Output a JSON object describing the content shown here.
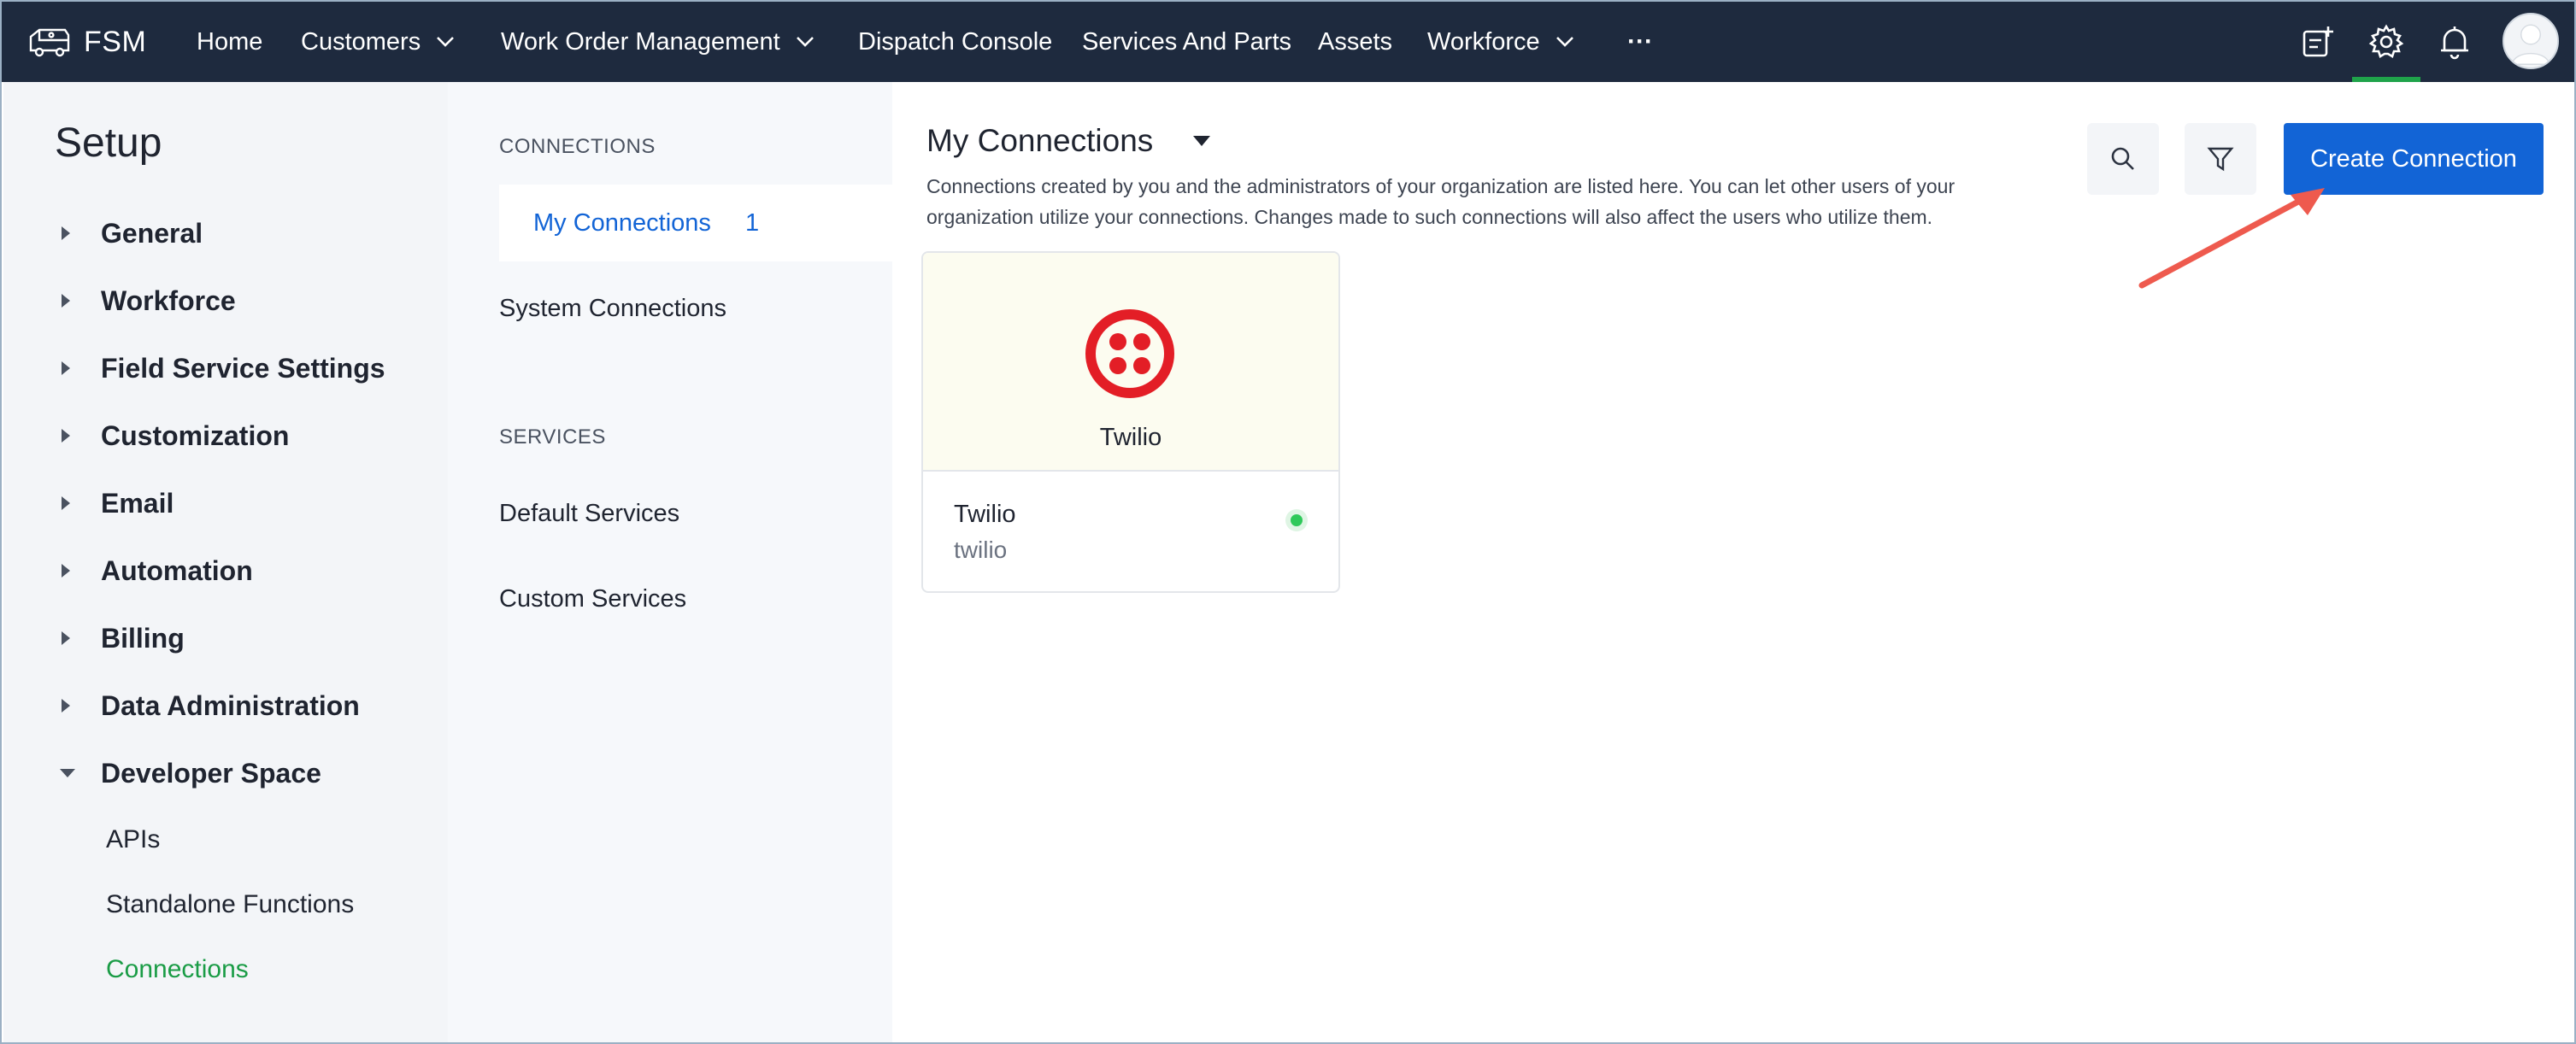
{
  "topnav": {
    "brand": "FSM",
    "items": [
      {
        "label": "Home",
        "has_dropdown": false
      },
      {
        "label": "Customers",
        "has_dropdown": true
      },
      {
        "label": "Work Order Management",
        "has_dropdown": true
      },
      {
        "label": "Dispatch Console",
        "has_dropdown": false
      },
      {
        "label": "Services And Parts",
        "has_dropdown": false
      },
      {
        "label": "Assets",
        "has_dropdown": false
      },
      {
        "label": "Workforce",
        "has_dropdown": true
      }
    ],
    "more": "···",
    "right_icons": [
      "add-note-icon",
      "gear-icon",
      "bell-icon",
      "avatar"
    ],
    "active_icon": "gear-icon",
    "colors": {
      "bar": "#1e2a3e",
      "active_indicator": "#1fa34a"
    }
  },
  "setup": {
    "title": "Setup",
    "items": [
      {
        "label": "General",
        "expanded": false
      },
      {
        "label": "Workforce",
        "expanded": false
      },
      {
        "label": "Field Service Settings",
        "expanded": false
      },
      {
        "label": "Customization",
        "expanded": false
      },
      {
        "label": "Email",
        "expanded": false
      },
      {
        "label": "Automation",
        "expanded": false
      },
      {
        "label": "Billing",
        "expanded": false
      },
      {
        "label": "Data Administration",
        "expanded": false
      },
      {
        "label": "Developer Space",
        "expanded": true
      }
    ],
    "sub_items": [
      {
        "label": "APIs",
        "active": false
      },
      {
        "label": "Standalone Functions",
        "active": false
      },
      {
        "label": "Connections",
        "active": true
      }
    ]
  },
  "connections_col": {
    "connections_heading": "CONNECTIONS",
    "my_connections": {
      "label": "My Connections",
      "count": "1"
    },
    "system_connections": "System Connections",
    "services_heading": "SERVICES",
    "default_services": "Default Services",
    "custom_services": "Custom Services"
  },
  "main": {
    "title": "My Connections",
    "description": "Connections created by you and the administrators of your organization are listed here. You can let other users of your organization utilize your connections. Changes made to such connections will also affect the users who utilize them.",
    "create_button": "Create Connection",
    "search_icon": "search-icon",
    "filter_icon": "filter-icon",
    "cards": [
      {
        "logo_label": "Twilio",
        "name": "Twilio",
        "service": "twilio",
        "status": "connected",
        "status_color": "#2fc95a",
        "logo_color": "#e31e26"
      }
    ],
    "accent": "#1264d6"
  }
}
